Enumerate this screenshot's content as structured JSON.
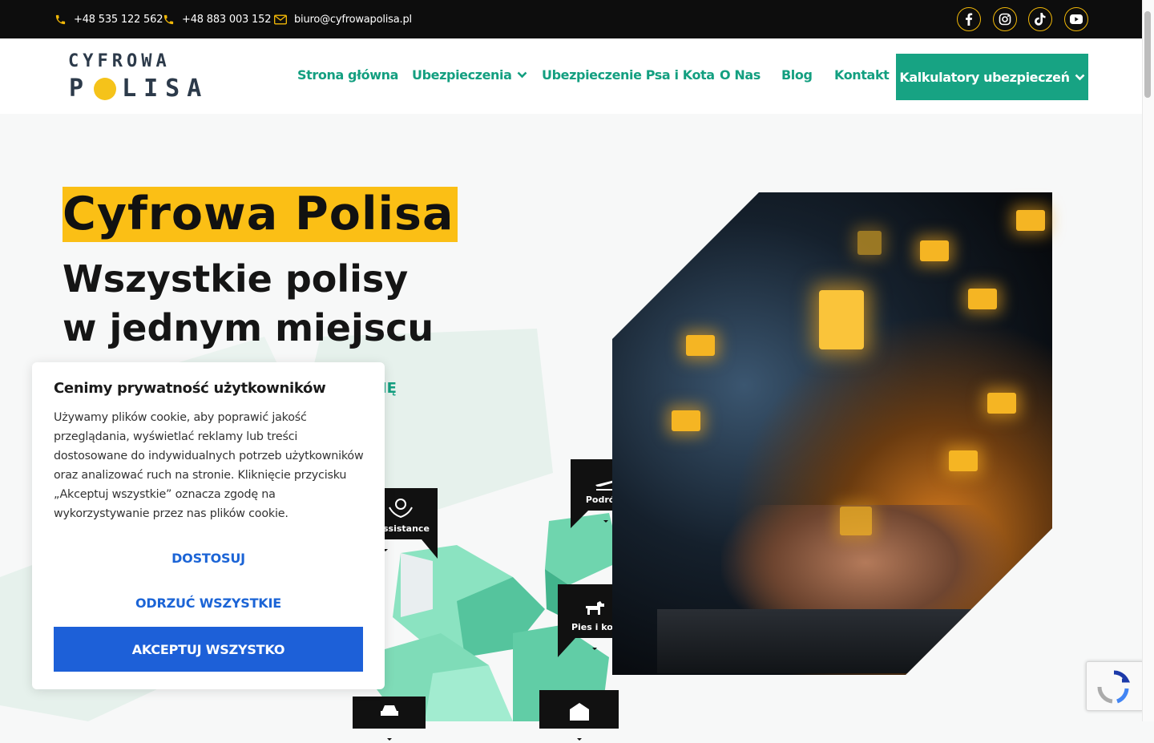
{
  "topbar": {
    "phone1": "+48 535 122 562",
    "phone2": "+48 883 003 152",
    "email": "biuro@cyfrowapolisa.pl",
    "icons": [
      "facebook-icon",
      "instagram-icon",
      "tiktok-icon",
      "youtube-icon"
    ],
    "accent": "#f2b807"
  },
  "logo": {
    "line1": "CYFROWA",
    "line2_a": "P",
    "line2_b": "LISA"
  },
  "nav": {
    "items": [
      "Strona główna",
      "Ubezpieczenia",
      "Ubezpieczenie Psa i Kota",
      "O Nas",
      "Blog",
      "Kontakt"
    ],
    "cta": "Kalkulatory ubezpieczeń",
    "color": "#139f80"
  },
  "hero": {
    "title": "Cyfrowa Polisa",
    "subtitle_line1": "Wszystkie polisy",
    "subtitle_line2": "w jednym miejscu",
    "partial_link": "SIĘ",
    "tags": [
      "Podróże",
      "ssistance",
      "Pies i kot"
    ]
  },
  "cookie": {
    "title": "Cenimy prywatność użytkowników",
    "text": "Używamy plików cookie, aby poprawić jakość przeglądania, wyświetlać reklamy lub treści dostosowane do indywidualnych potrzeb użytkowników oraz analizować ruch na stronie. Kliknięcie przycisku „Akceptuj wszystkie” oznacza zgodę na wykorzystywanie przez nas plików cookie.",
    "customize": "DOSTOSUJ",
    "reject": "ODRZUĆ WSZYSTKIE",
    "accept": "AKCEPTUJ WSZYSTKO",
    "accent": "#1d60d8"
  }
}
